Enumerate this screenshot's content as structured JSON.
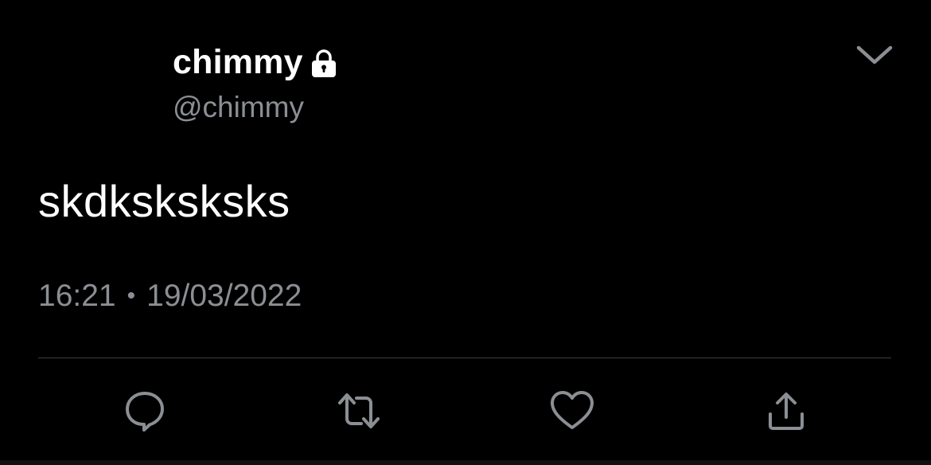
{
  "tweet": {
    "display_name": "chimmy",
    "handle": "@chimmy",
    "text": "skdksksksks",
    "time": "16:21",
    "separator": "•",
    "date": "19/03/2022"
  },
  "icons": {
    "lock": "lock-icon",
    "caret": "chevron-down-icon",
    "reply": "reply-icon",
    "retweet": "retweet-icon",
    "like": "heart-icon",
    "share": "share-icon"
  },
  "colors": {
    "background": "#000000",
    "primary_text": "#ffffff",
    "secondary_text": "#8b8f94",
    "icon": "#8b8f94",
    "divider": "#3a3d40"
  }
}
